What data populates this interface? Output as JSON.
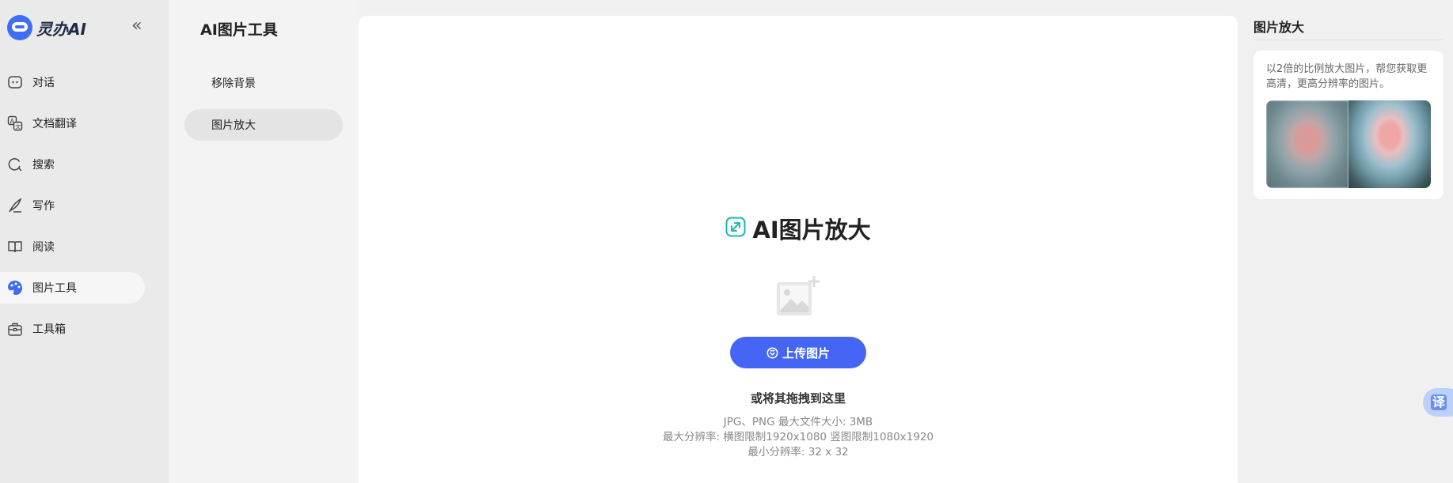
{
  "app": {
    "name": "灵办AI"
  },
  "colors": {
    "accent": "#4566f5",
    "icon_teal": "#1fb8b0"
  },
  "nav": {
    "items": [
      {
        "label": "对话",
        "icon": "chat-bot-icon"
      },
      {
        "label": "文档翻译",
        "icon": "translate-icon"
      },
      {
        "label": "搜索",
        "icon": "search-icon"
      },
      {
        "label": "写作",
        "icon": "pen-icon"
      },
      {
        "label": "阅读",
        "icon": "book-icon"
      },
      {
        "label": "图片工具",
        "icon": "palette-icon",
        "active": true
      },
      {
        "label": "工具箱",
        "icon": "toolbox-icon"
      }
    ]
  },
  "subnav": {
    "title": "AI图片工具",
    "items": [
      {
        "label": "移除背景"
      },
      {
        "label": "图片放大",
        "active": true
      }
    ]
  },
  "main": {
    "title": "AI图片放大",
    "upload_label": "上传图片",
    "drag_hint": "或将其拖拽到这里",
    "specs": [
      "JPG、PNG 最大文件大小: 3MB",
      "最大分辨率: 横图限制1920x1080 竖图限制1080x1920",
      "最小分辨率: 32 x 32"
    ]
  },
  "right_panel": {
    "title": "图片放大",
    "description": "以2倍的比例放大图片，帮您获取更高清，更高分辨率的图片。"
  },
  "translate_fab": {
    "label": "译"
  }
}
